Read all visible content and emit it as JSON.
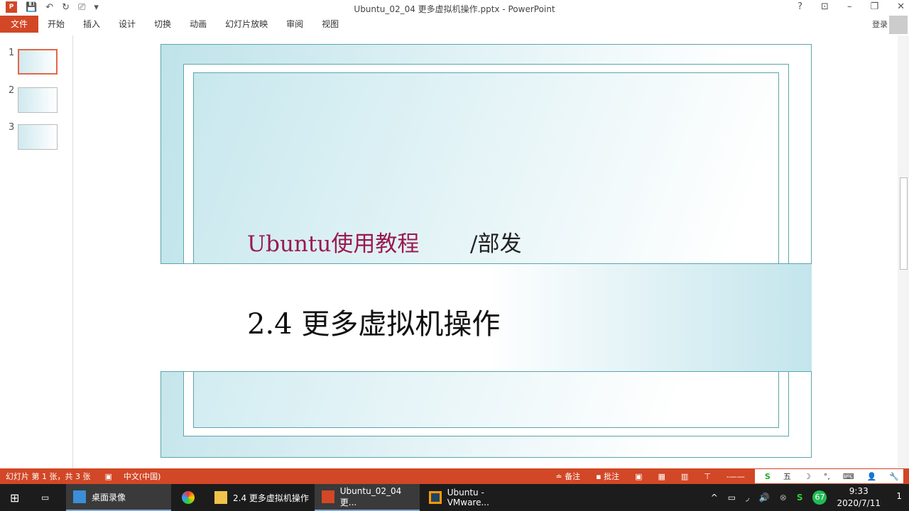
{
  "window": {
    "title": "Ubuntu_02_04 更多虚拟机操作.pptx - PowerPoint",
    "help": "?",
    "ribbon_display": "⊡",
    "minimize": "–",
    "restore": "❐",
    "close": "✕"
  },
  "qat": {
    "app_icon": "P",
    "save": "💾",
    "undo": "↶",
    "redo": "↻",
    "present": "⎚",
    "customize": "▾"
  },
  "ribbon": {
    "tabs": [
      "文件",
      "开始",
      "插入",
      "设计",
      "切换",
      "动画",
      "幻灯片放映",
      "审阅",
      "视图"
    ],
    "login": "登录"
  },
  "thumbnails": [
    {
      "num": "1"
    },
    {
      "num": "2"
    },
    {
      "num": "3"
    }
  ],
  "slide": {
    "subtitle": "Ubuntu使用教程",
    "author": "/部发",
    "title": "2.4 更多虚拟机操作"
  },
  "status": {
    "slide_info": "幻灯片 第 1 张，共 3 张",
    "language": "中文(中国)",
    "notes": "≐ 备注",
    "comments": "▪ 批注",
    "ime": [
      "S",
      "五",
      "☽",
      "°,",
      "⌨",
      "👤",
      "🔧"
    ]
  },
  "taskbar": {
    "items": [
      "桌面录像",
      "2.4 更多虚拟机操作",
      "Ubuntu_02_04 更...",
      "Ubuntu - VMware..."
    ],
    "tray_badge": "67",
    "time": "9:33",
    "date": "2020/7/11",
    "notif": "1"
  },
  "colors": {
    "accent": "#d24726",
    "slide_border": "#5aa6aa",
    "subtitle": "#9b1850"
  }
}
